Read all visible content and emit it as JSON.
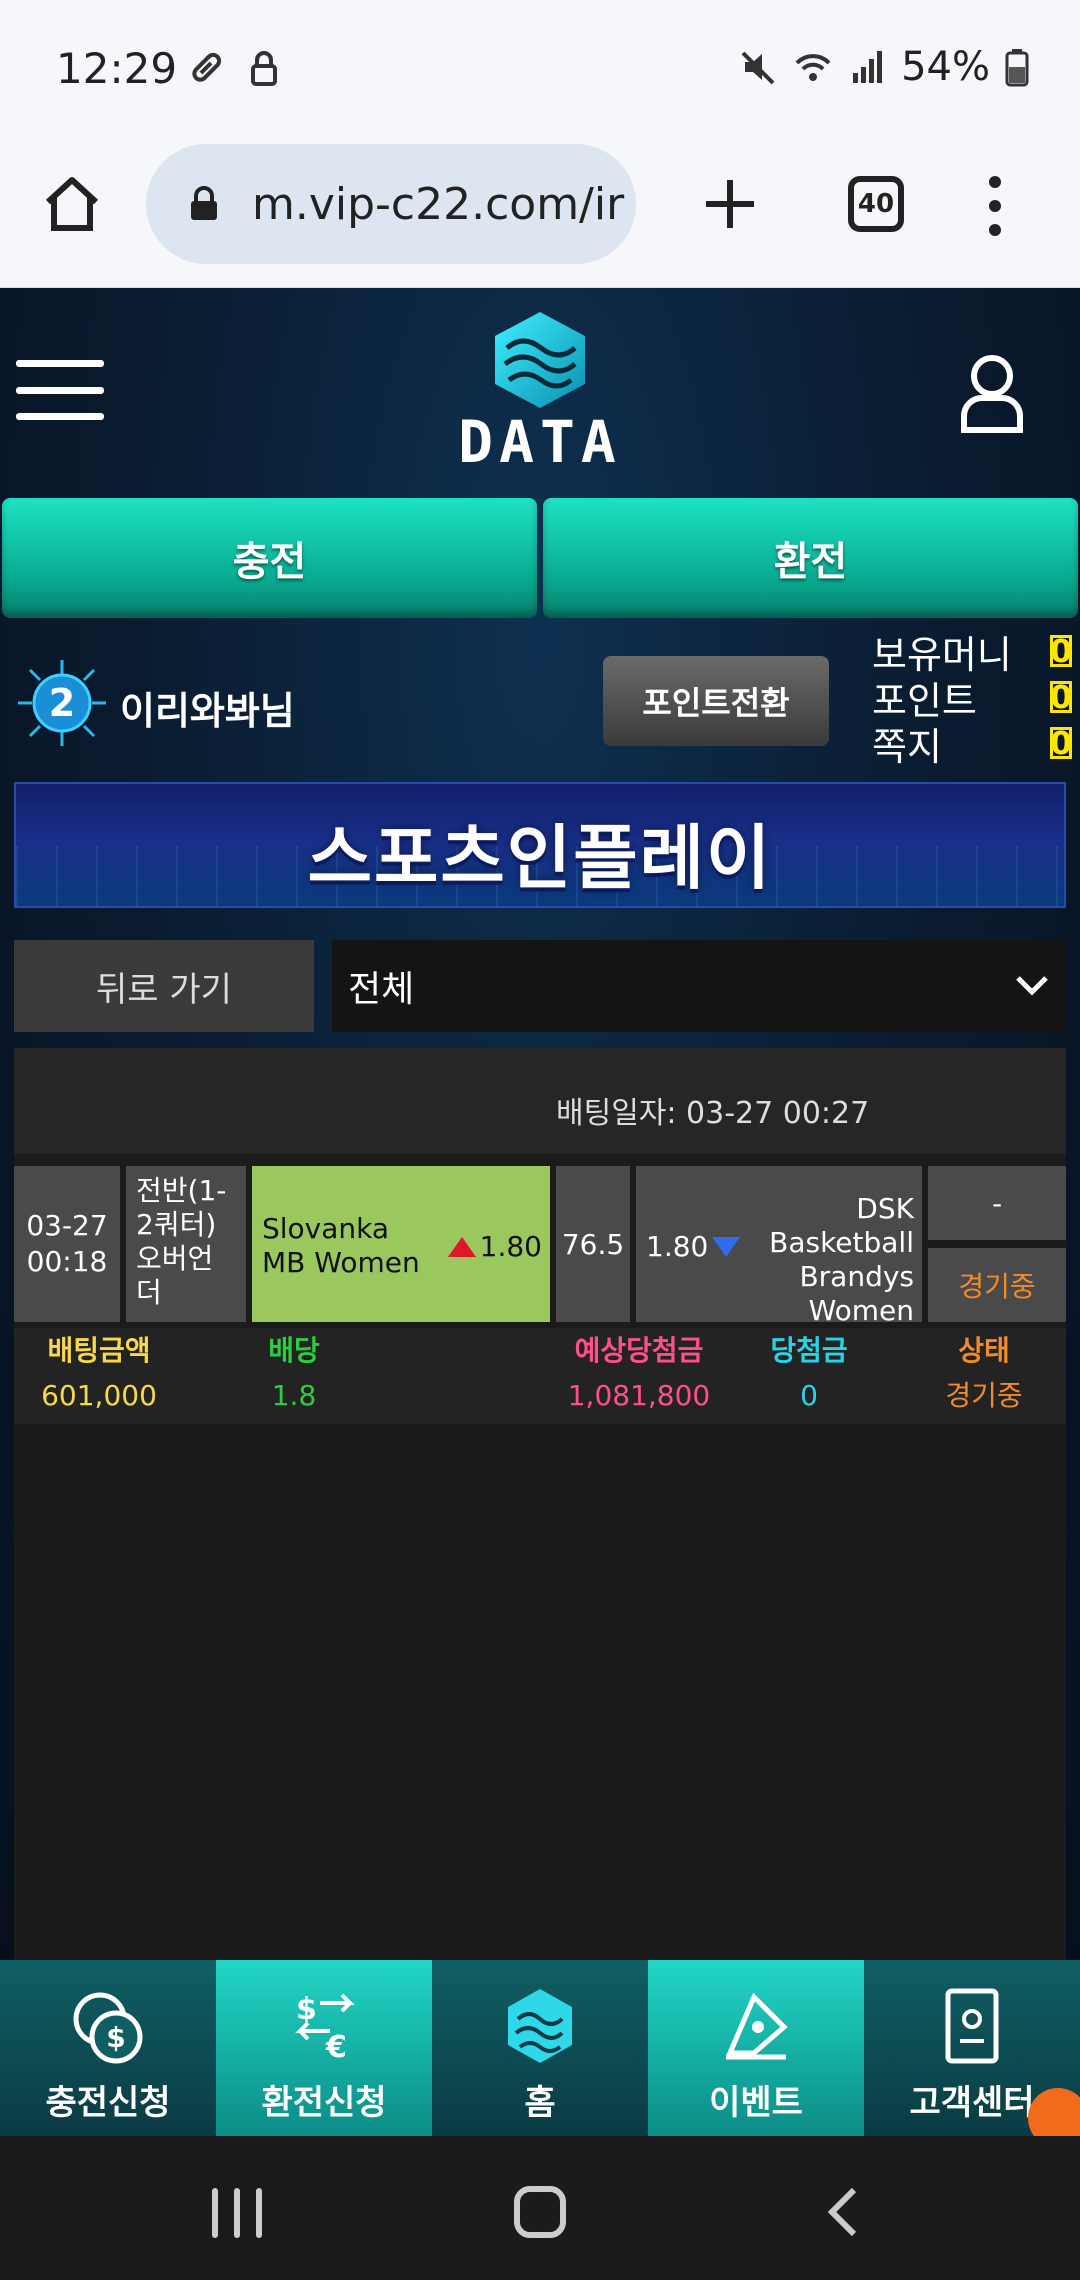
{
  "status_bar": {
    "time": "12:29",
    "battery": "54%"
  },
  "browser": {
    "url": "m.vip-c22.com/ir",
    "tab_count": "40"
  },
  "site": {
    "logo_text": "DATA",
    "buttons": {
      "deposit": "충전",
      "withdraw": "환전"
    },
    "user": {
      "level": "2",
      "name": "이리와봐님",
      "point_convert_label": "포인트전환",
      "balances": [
        {
          "label": "보유머니",
          "value": "0"
        },
        {
          "label": "포인트",
          "value": "0"
        },
        {
          "label": "쪽지",
          "value": "0"
        }
      ]
    },
    "banner_title": "스포츠인플레이",
    "filter": {
      "back_label": "뒤로 가기",
      "selected": "전체"
    },
    "bet": {
      "date_label": "배팅일자: 03-27 00:27",
      "game": {
        "date": "03-27",
        "time": "00:18",
        "type": "전반(1-2쿼터) 오버언더",
        "home_team": "Slovanka MB Women",
        "home_odds": "1.80",
        "line": "76.5",
        "away_odds": "1.80",
        "away_team": "DSK Basketball Brandys Women",
        "result": "-",
        "status": "경기중"
      },
      "summary": {
        "headers": {
          "amount": "배팅금액",
          "odds": "배당",
          "expected": "예상당첨금",
          "win": "당첨금",
          "status": "상태"
        },
        "values": {
          "amount": "601,000",
          "odds": "1.8",
          "expected": "1,081,800",
          "win": "0",
          "status": "경기중"
        },
        "colors": {
          "amount": "#f5d94a",
          "odds": "#2ecc40",
          "expected": "#ff4f8b",
          "win": "#27d3e6",
          "status": "#f08a2a"
        }
      }
    }
  },
  "bottom_nav": [
    {
      "label": "충전신청",
      "icon": "coins-icon",
      "active": false
    },
    {
      "label": "환전신청",
      "icon": "exchange-icon",
      "active": true
    },
    {
      "label": "홈",
      "icon": "logo-icon",
      "active": false
    },
    {
      "label": "이벤트",
      "icon": "event-icon",
      "active": true
    },
    {
      "label": "고객센터",
      "icon": "support-icon",
      "active": false
    }
  ]
}
